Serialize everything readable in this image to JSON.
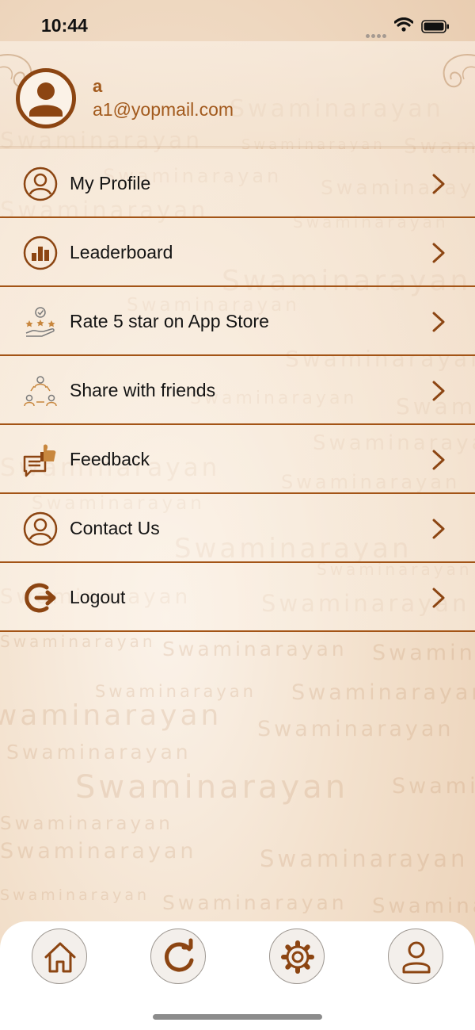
{
  "status_bar": {
    "time": "10:44",
    "icons": [
      "signal-dots-icon",
      "wifi-icon",
      "battery-icon"
    ]
  },
  "profile": {
    "name": "a",
    "email": "a1@yopmail.com",
    "avatar_icon": "user-silhouette-icon"
  },
  "menu": {
    "items": [
      {
        "label": "My Profile",
        "icon": "user-circle-icon"
      },
      {
        "label": "Leaderboard",
        "icon": "bar-chart-icon"
      },
      {
        "label": "Rate 5 star on App Store",
        "icon": "hand-stars-icon"
      },
      {
        "label": "Share with friends",
        "icon": "people-share-icon"
      },
      {
        "label": "Feedback",
        "icon": "feedback-thumb-icon"
      },
      {
        "label": "Contact Us",
        "icon": "user-circle-icon"
      },
      {
        "label": "Logout",
        "icon": "logout-icon"
      }
    ],
    "chevron_icon": "chevron-right-icon"
  },
  "watermark": {
    "text": "Swaminarayan"
  },
  "tab_bar": {
    "tabs": [
      {
        "icon": "home-icon"
      },
      {
        "icon": "refresh-icon"
      },
      {
        "icon": "gear-icon"
      },
      {
        "icon": "user-icon"
      }
    ]
  },
  "colors": {
    "accent": "#8c4512",
    "text_accent": "#a25a1d",
    "divider": "#a35416",
    "background_light": "#fbf3ea",
    "background_dark": "#e9cdb1",
    "tab_bar": "#ffffff"
  }
}
